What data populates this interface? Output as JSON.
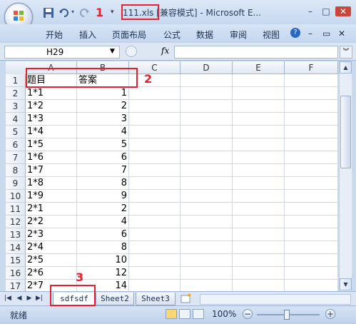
{
  "title_bar": {
    "file_name": "111.xls",
    "title_rest": " [兼容模式] - Microsoft E...",
    "minimize": "–",
    "restore": "□",
    "close": "✕"
  },
  "ribbon_tabs": [
    "开始",
    "插入",
    "页面布局",
    "公式",
    "数据",
    "审阅",
    "视图"
  ],
  "ribbon_controls": {
    "help": "?",
    "minimize": "–",
    "restore": "▭",
    "close": "✕"
  },
  "formula_bar": {
    "name_box": "H29",
    "fx_label": "fx",
    "formula": ""
  },
  "grid": {
    "columns": [
      "A",
      "B",
      "C",
      "D",
      "E",
      "F"
    ],
    "rows": [
      {
        "n": "1",
        "a": "题目",
        "b": "答案"
      },
      {
        "n": "2",
        "a": "1*1",
        "b": "1"
      },
      {
        "n": "3",
        "a": "1*2",
        "b": "2"
      },
      {
        "n": "4",
        "a": "1*3",
        "b": "3"
      },
      {
        "n": "5",
        "a": "1*4",
        "b": "4"
      },
      {
        "n": "6",
        "a": "1*5",
        "b": "5"
      },
      {
        "n": "7",
        "a": "1*6",
        "b": "6"
      },
      {
        "n": "8",
        "a": "1*7",
        "b": "7"
      },
      {
        "n": "9",
        "a": "1*8",
        "b": "8"
      },
      {
        "n": "10",
        "a": "1*9",
        "b": "9"
      },
      {
        "n": "11",
        "a": "2*1",
        "b": "2"
      },
      {
        "n": "12",
        "a": "2*2",
        "b": "4"
      },
      {
        "n": "13",
        "a": "2*3",
        "b": "6"
      },
      {
        "n": "14",
        "a": "2*4",
        "b": "8"
      },
      {
        "n": "15",
        "a": "2*5",
        "b": "10"
      },
      {
        "n": "16",
        "a": "2*6",
        "b": "12"
      },
      {
        "n": "17",
        "a": "2*7",
        "b": "14"
      }
    ]
  },
  "sheet_tabs": [
    "sdfsdf",
    "Sheet2",
    "Sheet3"
  ],
  "sheet_nav": [
    "|◀",
    "◀",
    "▶",
    "▶|"
  ],
  "status": {
    "ready": "就绪",
    "zoom": "100%",
    "zoom_out": "−",
    "zoom_in": "+"
  },
  "annotations": [
    "1",
    "2",
    "3"
  ],
  "colors": {
    "annotation_red": "#e8202a",
    "ribbon_blue": "#c3d6ef"
  },
  "icons": [
    "office-button-icon",
    "save-icon",
    "undo-icon",
    "redo-icon",
    "customize-qat-icon"
  ]
}
